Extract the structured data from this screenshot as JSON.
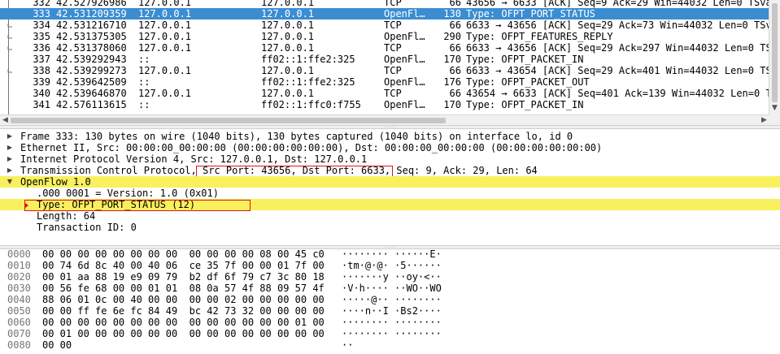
{
  "packet_list": {
    "rows": [
      {
        "no": "332",
        "time": "42.527926986",
        "src": "127.0.0.1",
        "dst": "127.0.0.1",
        "proto": "TCP",
        "len": "66",
        "info": "43656 → 6633 [ACK] Seq=9 Ack=29 Win=44032 Len=0 TSva"
      },
      {
        "no": "333",
        "time": "42.531209359",
        "src": "127.0.0.1",
        "dst": "127.0.0.1",
        "proto": "OpenFl…",
        "len": "130",
        "info": "Type: OFPT_PORT_STATUS",
        "selected": true
      },
      {
        "no": "334",
        "time": "42.531216710",
        "src": "127.0.0.1",
        "dst": "127.0.0.1",
        "proto": "TCP",
        "len": "66",
        "info": "6633 → 43656 [ACK] Seq=29 Ack=73 Win=44032 Len=0 TSv"
      },
      {
        "no": "335",
        "time": "42.531375305",
        "src": "127.0.0.1",
        "dst": "127.0.0.1",
        "proto": "OpenFl…",
        "len": "290",
        "info": "Type: OFPT_FEATURES_REPLY"
      },
      {
        "no": "336",
        "time": "42.531378060",
        "src": "127.0.0.1",
        "dst": "127.0.0.1",
        "proto": "TCP",
        "len": "66",
        "info": "6633 → 43656 [ACK] Seq=29 Ack=297 Win=44032 Len=0 TS"
      },
      {
        "no": "337",
        "time": "42.539292943",
        "src": "::",
        "dst": "ff02::1:ffe2:325",
        "proto": "OpenFl…",
        "len": "170",
        "info": "Type: OFPT_PACKET_IN"
      },
      {
        "no": "338",
        "time": "42.539299273",
        "src": "127.0.0.1",
        "dst": "127.0.0.1",
        "proto": "TCP",
        "len": "66",
        "info": "6633 → 43654 [ACK] Seq=29 Ack=401 Win=44032 Len=0 TS"
      },
      {
        "no": "339",
        "time": "42.539642509",
        "src": "::",
        "dst": "ff02::1:ffe2:325",
        "proto": "OpenFl…",
        "len": "176",
        "info": "Type: OFPT_PACKET_OUT"
      },
      {
        "no": "340",
        "time": "42.539646870",
        "src": "127.0.0.1",
        "dst": "127.0.0.1",
        "proto": "TCP",
        "len": "66",
        "info": "43654 → 6633 [ACK] Seq=401 Ack=139 Win=44032 Len=0 T"
      },
      {
        "no": "341",
        "time": "42.576113615",
        "src": "::",
        "dst": "ff02::1:ffc0:f755",
        "proto": "OpenFl…",
        "len": "170",
        "info": "Type: OFPT_PACKET_IN"
      }
    ]
  },
  "details": {
    "frame": "Frame 333: 130 bytes on wire (1040 bits), 130 bytes captured (1040 bits) on interface lo, id 0",
    "ethernet": "Ethernet II, Src: 00:00:00_00:00:00 (00:00:00:00:00:00), Dst: 00:00:00_00:00:00 (00:00:00:00:00:00)",
    "ip": "Internet Protocol Version 4, Src: 127.0.0.1, Dst: 127.0.0.1",
    "tcp": "Transmission Control Protocol, Src Port: 43656, Dst Port: 6633, Seq: 9, Ack: 29, Len: 64",
    "openflow": "OpenFlow 1.0",
    "version": ".000 0001 = Version: 1.0 (0x01)",
    "type": "Type: OFPT_PORT_STATUS (12)",
    "length": "Length: 64",
    "xid": "Transaction ID: 0"
  },
  "bytes": {
    "rows": [
      {
        "off": "0000",
        "hex": "00 00 00 00 00 00 00 00  00 00 00 00 08 00 45 c0",
        "ascii": "········ ······E·"
      },
      {
        "off": "0010",
        "hex": "00 74 6d 8c 40 00 40 06  ce 35 7f 00 00 01 7f 00",
        "ascii": "·tm·@·@· ·5······"
      },
      {
        "off": "0020",
        "hex": "00 01 aa 88 19 e9 09 79  b2 df 6f 79 c7 3c 80 18",
        "ascii": "·······y ··oy·<··"
      },
      {
        "off": "0030",
        "hex": "00 56 fe 68 00 00 01 01  08 0a 57 4f 88 09 57 4f",
        "ascii": "·V·h···· ··WO··WO"
      },
      {
        "off": "0040",
        "hex": "88 06 01 0c 00 40 00 00  00 00 02 00 00 00 00 00",
        "ascii": "·····@·· ········"
      },
      {
        "off": "0050",
        "hex": "00 00 ff fe 6e fc 84 49  bc 42 73 32 00 00 00 00",
        "ascii": "····n··I ·Bs2····"
      },
      {
        "off": "0060",
        "hex": "00 00 00 00 00 00 00 00  00 00 00 00 00 00 01 00",
        "ascii": "········ ········"
      },
      {
        "off": "0070",
        "hex": "00 01 00 00 00 00 00 00  00 00 00 00 00 00 00 00",
        "ascii": "········ ········"
      },
      {
        "off": "0080",
        "hex": "00 00",
        "ascii": "··"
      }
    ]
  },
  "colors": {
    "selected_row": "#3b8dd1",
    "field_highlight": "#f8f05c",
    "annotation_box": "#e0121a"
  }
}
